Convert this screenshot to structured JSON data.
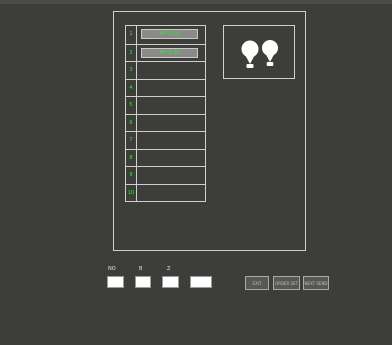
{
  "slots": [
    {
      "number": "1",
      "value": "MP-0.00"
    },
    {
      "number": "2",
      "value": "MP-0.00"
    },
    {
      "number": "3",
      "value": ""
    },
    {
      "number": "4",
      "value": ""
    },
    {
      "number": "5",
      "value": ""
    },
    {
      "number": "6",
      "value": ""
    },
    {
      "number": "7",
      "value": ""
    },
    {
      "number": "8",
      "value": ""
    },
    {
      "number": "9",
      "value": ""
    },
    {
      "number": "10",
      "value": ""
    }
  ],
  "bulb_icon": "two-bulbs-icon",
  "fields": {
    "no_label": "NO",
    "b_label": "B",
    "z_label": "Z",
    "no_value": "",
    "b_value": "",
    "z_value": "",
    "extra_value": ""
  },
  "buttons": {
    "exit": "EXIT",
    "order_set": "ORDER SET",
    "next_send": "NEXT SEND"
  },
  "colors": {
    "background": "#3d3d3a",
    "outline": "#cfcfcf",
    "slot_text": "#39e639",
    "field_fill": "#ffffff"
  }
}
